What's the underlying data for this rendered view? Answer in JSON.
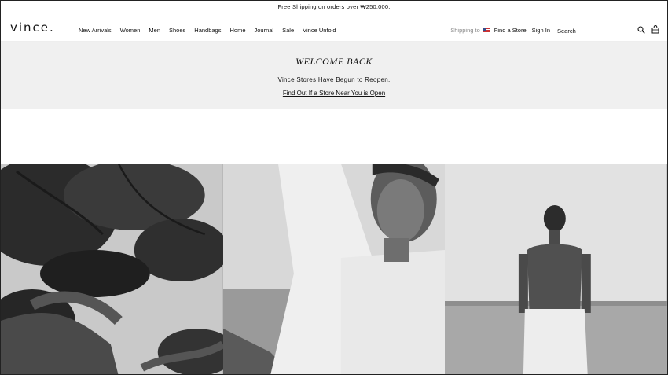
{
  "promo": {
    "text": "Free Shipping on orders over ₩250,000."
  },
  "header": {
    "logo": "VINCE.",
    "nav": [
      "New Arrivals",
      "Women",
      "Men",
      "Shoes",
      "Handbags",
      "Home",
      "Journal",
      "Sale",
      "Vince Unfold"
    ],
    "shipping_label": "Shipping to",
    "find_store": "Find a Store",
    "sign_in": "Sign In",
    "search_placeholder": "Search",
    "icons": [
      "search-icon",
      "bag-icon",
      "us-flag-icon"
    ]
  },
  "banner": {
    "title": "WELCOME BACK",
    "subtitle": "Vince Stores Have Begun to Reopen.",
    "link": "Find Out If a Store Near You is Open"
  },
  "colors": {
    "banner_bg": "#f0f0f0",
    "text": "#111111",
    "muted": "#888888"
  }
}
